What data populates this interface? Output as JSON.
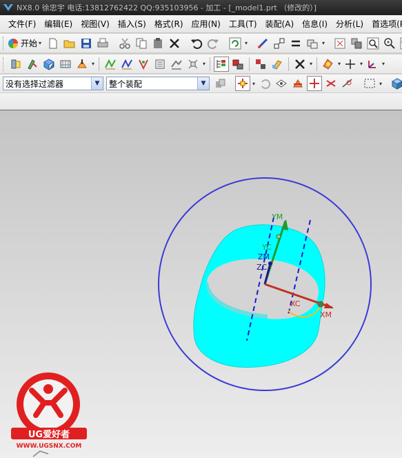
{
  "window": {
    "title": "NX8.0 徐忠宇 电话:13812762422 QQ:935103956 - 加工 - [_model1.prt （修改的）]"
  },
  "menubar": {
    "items": [
      {
        "label": "文件(F)"
      },
      {
        "label": "编辑(E)"
      },
      {
        "label": "视图(V)"
      },
      {
        "label": "插入(S)"
      },
      {
        "label": "格式(R)"
      },
      {
        "label": "应用(N)"
      },
      {
        "label": "工具(T)"
      },
      {
        "label": "装配(A)"
      },
      {
        "label": "信息(I)"
      },
      {
        "label": "分析(L)"
      },
      {
        "label": "首选项(P)"
      }
    ]
  },
  "toolbar_standard": {
    "start_label": "开始",
    "icons": [
      "new-file",
      "open-folder",
      "save",
      "print",
      "cut",
      "copy",
      "paste",
      "delete",
      "undo",
      "redo",
      "refresh",
      "measure",
      "snap",
      "equals",
      "layer"
    ]
  },
  "toolbar_selection": {
    "filter_value": "没有选择过滤器",
    "scope_value": "整个装配"
  },
  "viewport": {
    "csys_labels": {
      "ym": "YM",
      "yc": "YC",
      "zm": "ZM",
      "zc": "ZC",
      "xc": "XC",
      "xm": "XM"
    },
    "colors": {
      "background_top": "#c4c4c4",
      "background_bottom": "#eeeeee",
      "cylinder": "#00ffff",
      "circle": "#3a3ad8",
      "axis_dash": "#1a1acc",
      "x_axis": "#c03020",
      "y_axis": "#1c9c30",
      "z_axis": "#1a1a8c",
      "rotate_handle": "#f0c020"
    }
  },
  "watermark": {
    "brand": "UG爱好者",
    "url": "WWW.UGSNX.COM",
    "color": "#e02020"
  }
}
